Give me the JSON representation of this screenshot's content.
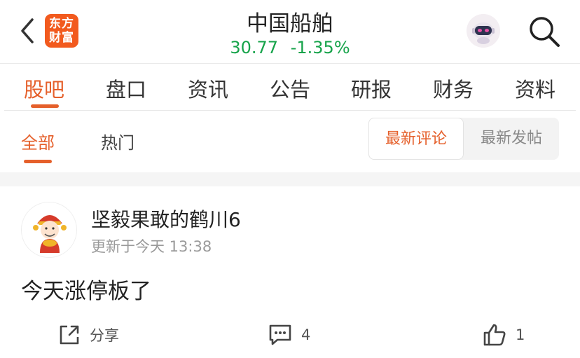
{
  "header": {
    "brand_logo_text": "东方财富",
    "stock_name": "中国船舶",
    "price": "30.77",
    "change_pct": "-1.35%"
  },
  "main_tabs": [
    {
      "label": "股吧",
      "active": true
    },
    {
      "label": "盘口"
    },
    {
      "label": "资讯"
    },
    {
      "label": "公告"
    },
    {
      "label": "研报"
    },
    {
      "label": "财务"
    },
    {
      "label": "资料"
    }
  ],
  "sub_tabs": [
    {
      "label": "全部",
      "active": true
    },
    {
      "label": "热门"
    }
  ],
  "sort": {
    "latest_comment": "最新评论",
    "latest_post": "最新发帖"
  },
  "post": {
    "username": "坚毅果敢的鹤川6",
    "meta": "更新于今天 13:38",
    "content": "今天涨停板了",
    "share_label": "分享",
    "comment_count": "4",
    "like_count": "1"
  },
  "icons": {
    "back": "back-chevron-icon",
    "search": "search-icon",
    "robot": "robot-avatar-icon",
    "share": "share-icon",
    "comment": "comment-icon",
    "like": "thumbs-up-icon"
  },
  "colors": {
    "accent": "#e5602b",
    "brand": "#f25a1e",
    "quote_green": "#16a34a"
  }
}
